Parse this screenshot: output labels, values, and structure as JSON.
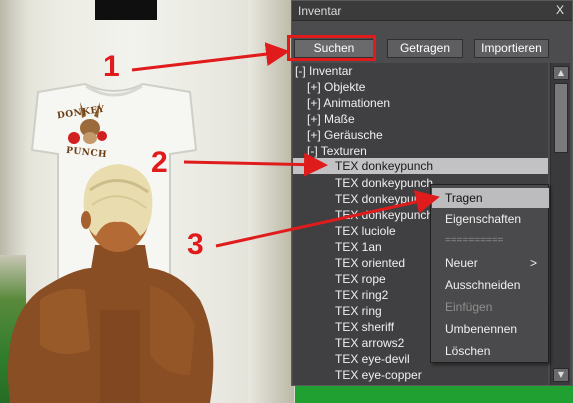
{
  "window": {
    "title": "Inventar",
    "close_label": "X"
  },
  "tabs": [
    {
      "label": "Suchen"
    },
    {
      "label": "Getragen"
    },
    {
      "label": "Importieren"
    }
  ],
  "tree": [
    {
      "label": "[-] Inventar"
    },
    {
      "label": "[+] Objekte"
    },
    {
      "label": "[+] Animationen"
    },
    {
      "label": "[+] Maße"
    },
    {
      "label": "[+] Geräusche"
    },
    {
      "label": "[-] Texturen"
    },
    {
      "label": "TEX donkeypunch"
    },
    {
      "label": "TEX donkeypunch"
    },
    {
      "label": "TEX donkeypunch"
    },
    {
      "label": "TEX donkeypunch"
    },
    {
      "label": "TEX luciole"
    },
    {
      "label": "TEX 1an"
    },
    {
      "label": "TEX oriented"
    },
    {
      "label": "TEX rope"
    },
    {
      "label": "TEX ring2"
    },
    {
      "label": "TEX ring"
    },
    {
      "label": "TEX sheriff"
    },
    {
      "label": "TEX arrows2"
    },
    {
      "label": "TEX eye-devil"
    },
    {
      "label": "TEX eye-copper"
    }
  ],
  "context_menu": {
    "items": [
      {
        "label": "Tragen"
      },
      {
        "label": "Eigenschaften"
      },
      {
        "label": "=========="
      },
      {
        "label": "Neuer",
        "submenu_arrow": ">"
      },
      {
        "label": "Ausschneiden"
      },
      {
        "label": "Einfügen"
      },
      {
        "label": "Umbenennen"
      },
      {
        "label": "Löschen"
      }
    ]
  },
  "annotations": [
    "1",
    "2",
    "3"
  ],
  "scene": {
    "logo_top": "DONKEY",
    "logo_bottom": "PUNCH"
  },
  "colors": {
    "annotation_red": "#e01b1b",
    "selection": "#c2c2c4",
    "window_bg": "#464648"
  },
  "icons": {
    "scroll_up": "triangle-up",
    "scroll_down": "triangle-down"
  }
}
